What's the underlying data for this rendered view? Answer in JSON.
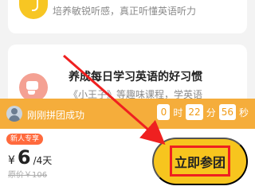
{
  "feature_top": {
    "description": "培养敏锐听感，真正听懂英语听力",
    "icon": "headphones-icon"
  },
  "feature_mid": {
    "title": "养成每日学习英语的好习惯",
    "description": "《小王子》等趣味课程，学英语",
    "icon": "thumbs-up-icon"
  },
  "group": {
    "status": "刚刚拼团成功",
    "countdown": {
      "days": "0",
      "day_unit": "时",
      "hours": "22",
      "hour_unit": "分",
      "minutes": "56",
      "minute_unit": "秒"
    }
  },
  "purchase": {
    "badge": "新人专享",
    "currency": "¥",
    "price": "6",
    "period": "/4天",
    "original_price": "原价￥106",
    "button_label": "立即参团"
  },
  "colors": {
    "accent": "#f7c51e",
    "bar": "#f5ad3b",
    "highlight": "#ef2020"
  }
}
